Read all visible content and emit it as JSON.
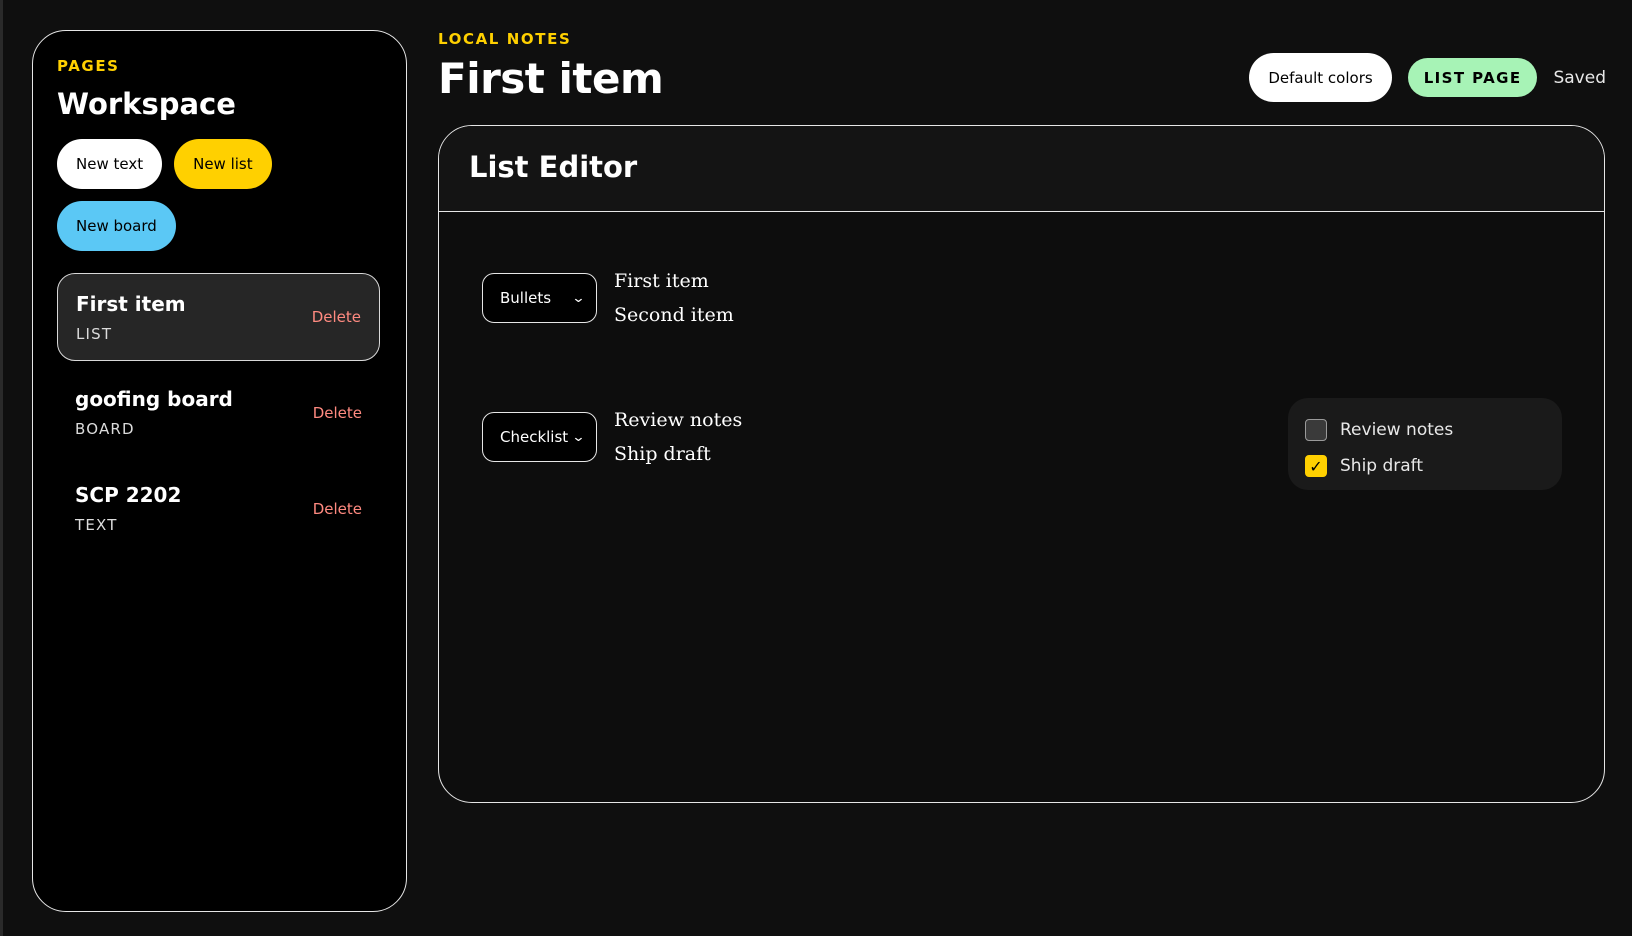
{
  "sidebar": {
    "eyebrow": "PAGES",
    "title": "Workspace",
    "buttons": {
      "new_text": "New text",
      "new_list": "New list",
      "new_board": "New board"
    },
    "pages": [
      {
        "title": "First item",
        "type": "LIST",
        "delete": "Delete",
        "active": true
      },
      {
        "title": "goofing board",
        "type": "BOARD",
        "delete": "Delete",
        "active": false
      },
      {
        "title": "SCP 2202",
        "type": "TEXT",
        "delete": "Delete",
        "active": false
      }
    ]
  },
  "header": {
    "eyebrow": "LOCAL NOTES",
    "title": "First item",
    "default_colors": "Default colors",
    "badge": "LIST PAGE",
    "status": "Saved"
  },
  "editor": {
    "title": "List Editor",
    "blocks": [
      {
        "style": "Bullets",
        "items": [
          "First item",
          "Second item"
        ]
      },
      {
        "style": "Checklist",
        "items": [
          "Review notes",
          "Ship draft"
        ]
      }
    ],
    "checklist_preview": [
      {
        "label": "Review notes",
        "checked": false
      },
      {
        "label": "Ship draft",
        "checked": true
      }
    ]
  },
  "colors": {
    "accent_yellow": "#ffd000",
    "accent_blue": "#5bc8f5",
    "accent_green": "#a7f3b6",
    "delete_red": "#ff8a80",
    "background": "#0f0f0f"
  }
}
